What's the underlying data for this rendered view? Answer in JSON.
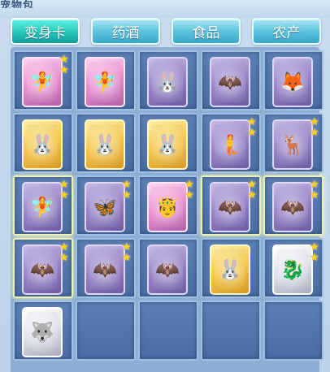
{
  "window": {
    "title": "宠物包"
  },
  "tabs": [
    {
      "label": "变身卡",
      "active": true
    },
    {
      "label": "药酒",
      "active": false
    },
    {
      "label": "食品",
      "active": false
    },
    {
      "label": "农产",
      "active": false
    }
  ],
  "slots": [
    {
      "card": "pink",
      "figure": "🧚",
      "figure_name": "fairy-girl-icon",
      "stars": 2,
      "glow": false
    },
    {
      "card": "pink",
      "figure": "🧚",
      "figure_name": "fairy-girl-icon",
      "stars": 0,
      "glow": false
    },
    {
      "card": "violet",
      "figure": "🐰",
      "figure_name": "rabbit-icon",
      "stars": 0,
      "glow": false
    },
    {
      "card": "violet",
      "figure": "🦇",
      "figure_name": "bat-dancer-icon",
      "stars": 0,
      "glow": false
    },
    {
      "card": "violet",
      "figure": "🦊",
      "figure_name": "fox-icon",
      "stars": 0,
      "glow": false
    },
    {
      "card": "gold",
      "figure": "🐰",
      "figure_name": "bunny-girl-icon",
      "stars": 0,
      "glow": false
    },
    {
      "card": "gold",
      "figure": "🐰",
      "figure_name": "bunny-girl-icon",
      "stars": 0,
      "glow": false
    },
    {
      "card": "gold",
      "figure": "🐰",
      "figure_name": "bunny-girl-icon",
      "stars": 0,
      "glow": false
    },
    {
      "card": "violet",
      "figure": "🧜",
      "figure_name": "blue-warrior-icon",
      "stars": 2,
      "glow": false
    },
    {
      "card": "violet",
      "figure": "🦌",
      "figure_name": "blue-deer-icon",
      "stars": 2,
      "glow": false
    },
    {
      "card": "violet",
      "figure": "🧚",
      "figure_name": "winged-girl-icon",
      "stars": 2,
      "glow": true
    },
    {
      "card": "violet",
      "figure": "🦋",
      "figure_name": "crystal-fairy-icon",
      "stars": 2,
      "glow": false
    },
    {
      "card": "pink",
      "figure": "🤴",
      "figure_name": "prince-icon",
      "stars": 2,
      "glow": false
    },
    {
      "card": "violet",
      "figure": "🦇",
      "figure_name": "bat-dancer-icon",
      "stars": 2,
      "glow": true
    },
    {
      "card": "violet",
      "figure": "🦇",
      "figure_name": "bat-dancer-icon",
      "stars": 2,
      "glow": true
    },
    {
      "card": "violet",
      "figure": "🦇",
      "figure_name": "bat-dancer-icon",
      "stars": 2,
      "glow": true
    },
    {
      "card": "violet",
      "figure": "🦇",
      "figure_name": "bat-dancer-icon",
      "stars": 2,
      "glow": false
    },
    {
      "card": "violet",
      "figure": "🦇",
      "figure_name": "bat-dancer-icon",
      "stars": 0,
      "glow": false
    },
    {
      "card": "gold",
      "figure": "🐰",
      "figure_name": "bunny-girl-icon",
      "stars": 0,
      "glow": false
    },
    {
      "card": "silver",
      "figure": "🐉",
      "figure_name": "dragon-icon",
      "stars": 2,
      "glow": false
    },
    {
      "card": "silver",
      "figure": "🐺",
      "figure_name": "beast-icon",
      "stars": 0,
      "glow": false
    },
    {
      "card": "",
      "figure": "",
      "figure_name": "",
      "stars": 0,
      "glow": false
    },
    {
      "card": "",
      "figure": "",
      "figure_name": "",
      "stars": 0,
      "glow": false
    },
    {
      "card": "",
      "figure": "",
      "figure_name": "",
      "stars": 0,
      "glow": false
    },
    {
      "card": "",
      "figure": "",
      "figure_name": "",
      "stars": 0,
      "glow": false
    }
  ]
}
